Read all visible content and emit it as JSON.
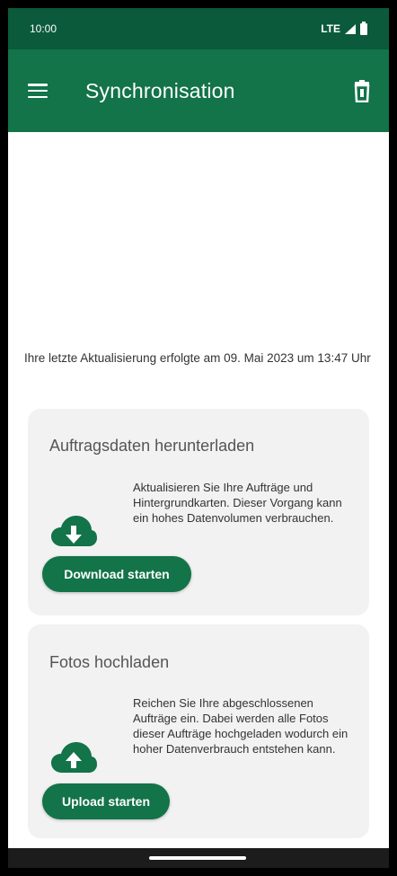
{
  "status_bar": {
    "time": "10:00",
    "network": "LTE"
  },
  "app_bar": {
    "title": "Synchronisation"
  },
  "main": {
    "last_update_text": "Ihre letzte Aktualisierung erfolgte am 09. Mai 2023 um 13:47 Uhr"
  },
  "download_card": {
    "title": "Auftragsdaten herunterladen",
    "description": "Aktualisieren Sie Ihre Aufträge und Hintergrundkarten. Dieser Vorgang kann ein hohes Datenvolumen verbrauchen.",
    "button_label": "Download starten",
    "icon": "cloud-download-icon"
  },
  "upload_card": {
    "title": "Fotos hochladen",
    "description": "Reichen Sie Ihre abgeschlossenen Aufträge ein. Dabei werden alle Fotos dieser Aufträge hochgeladen wodurch ein hoher Datenverbrauch entstehen kann.",
    "button_label": "Upload starten",
    "icon": "cloud-upload-icon"
  },
  "colors": {
    "status_bar": "#0b5a3b",
    "app_bar": "#137349",
    "button": "#137349",
    "card_background": "#f2f2f2"
  }
}
